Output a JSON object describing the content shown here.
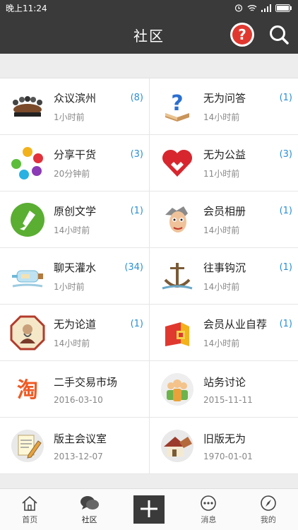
{
  "status_bar": {
    "time": "晚上11:24"
  },
  "header": {
    "title": "社区"
  },
  "boards": [
    {
      "name": "众议滨州",
      "time": "1小时前",
      "count": "(8)",
      "icon": "meeting-icon"
    },
    {
      "name": "无为问答",
      "time": "14小时前",
      "count": "(1)",
      "icon": "question-icon"
    },
    {
      "name": "分享干货",
      "time": "20分钟前",
      "count": "(3)",
      "icon": "share-icon"
    },
    {
      "name": "无为公益",
      "time": "11小时前",
      "count": "(3)",
      "icon": "charity-icon"
    },
    {
      "name": "原创文学",
      "time": "14小时前",
      "count": "(1)",
      "icon": "literature-icon"
    },
    {
      "name": "会员相册",
      "time": "14小时前",
      "count": "(1)",
      "icon": "album-icon"
    },
    {
      "name": "聊天灌水",
      "time": "1小时前",
      "count": "(34)",
      "icon": "bottle-icon"
    },
    {
      "name": "往事钩沉",
      "time": "14小时前",
      "count": "(1)",
      "icon": "anchor-icon"
    },
    {
      "name": "无为论道",
      "time": "14小时前",
      "count": "(1)",
      "icon": "philosophy-icon"
    },
    {
      "name": "会员从业自荐",
      "time": "14小时前",
      "count": "(1)",
      "icon": "career-icon"
    },
    {
      "name": "二手交易市场",
      "time": "2016-03-10",
      "count": "",
      "icon": "taobao-icon"
    },
    {
      "name": "站务讨论",
      "time": "2015-11-11",
      "count": "",
      "icon": "people-icon"
    },
    {
      "name": "版主会议室",
      "time": "2013-12-07",
      "count": "",
      "icon": "notepad-icon"
    },
    {
      "name": "旧版无为",
      "time": "1970-01-01",
      "count": "",
      "icon": "house-icon"
    }
  ],
  "tabbar": {
    "home": "首页",
    "community": "社区",
    "messages": "消息",
    "mine": "我的"
  }
}
